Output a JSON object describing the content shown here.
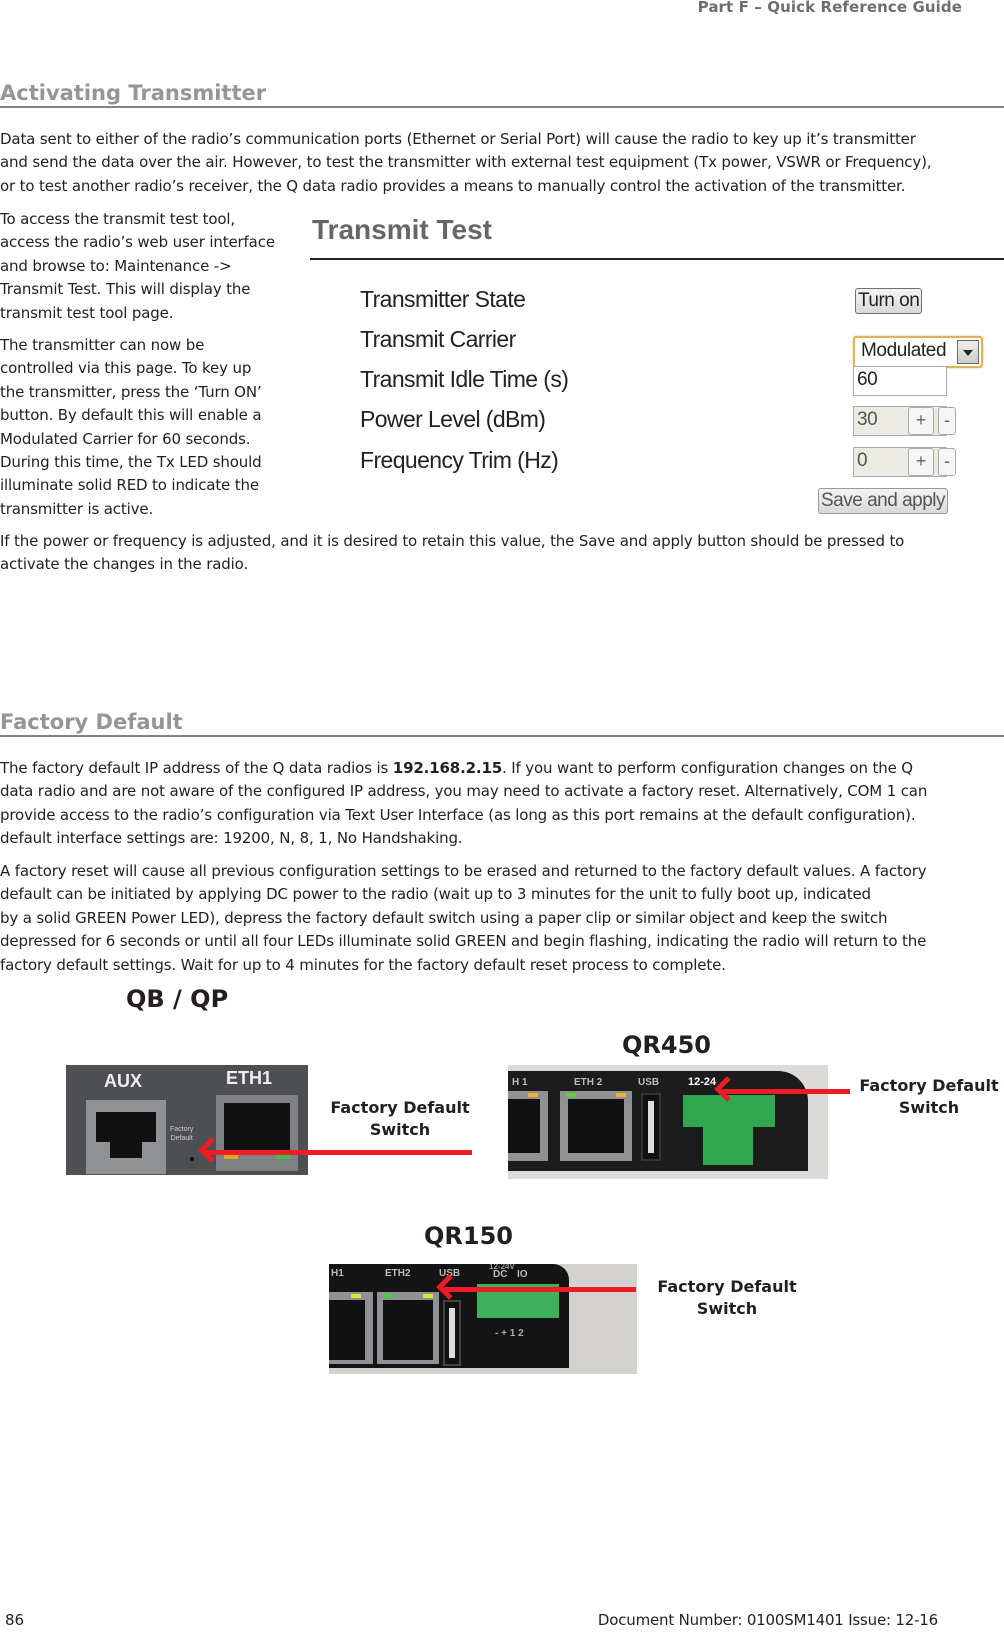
{
  "header": {
    "title": "Part F – Quick Reference Guide"
  },
  "activating": {
    "title": "Activating Transmitter",
    "intro_lines": [
      "Data sent to either of the radio’s communication ports (Ethernet or Serial Port) will cause the radio to key up it’s transmitter",
      "and send the data over the air. However, to test the transmitter with external test equipment (Tx power, VSWR or Frequency),",
      "or to test another radio’s receiver, the Q data radio provides a means to manually control the activation of the transmitter."
    ],
    "access_lines": [
      "To access the transmit test tool,",
      "access the radio’s web user interface",
      "and browse to: Maintenance ->",
      "Transmit Test. This will display the",
      "transmit test tool page."
    ],
    "control_lines": [
      "The transmitter can now be",
      "controlled via this page. To key up",
      "the transmitter, press the ‘Turn ON’",
      "button. By default this will enable a",
      "Modulated Carrier for 60 seconds.",
      "During this time, the Tx LED should",
      "illuminate solid RED to indicate the",
      "transmitter is active."
    ],
    "save_lines": [
      "If the power or frequency is adjusted, and it is desired to retain this value, the Save and apply button should be pressed to",
      "activate the changes in the radio."
    ]
  },
  "transmit_test": {
    "title": "Transmit Test",
    "rows": [
      {
        "label": "Transmitter State"
      },
      {
        "label": "Transmit Carrier"
      },
      {
        "label": "Transmit Idle Time (s)"
      },
      {
        "label": "Power Level (dBm)"
      },
      {
        "label": "Frequency Trim (Hz)"
      }
    ],
    "turn_on_label": "Turn on",
    "carrier_selected": "Modulated",
    "idle_time_value": "60",
    "power_level_value": "30",
    "frequency_trim_value": "0",
    "plus_label": "+",
    "minus_label": "-",
    "save_label": "Save and apply"
  },
  "factory": {
    "title": "Factory Default",
    "p1_line1_pre": "The factory default IP address of the Q data radios is ",
    "p1_ip": "192.168.2.15",
    "p1_line1_post": ". If you want to perform configuration changes on the Q",
    "p1_lines": [
      "data radio and are not aware of the configured IP address, you may need to activate a factory reset. Alternatively, COM 1 can",
      "provide access to the radio’s configuration via Text User Interface (as long as this port remains at the default configuration).",
      "default interface settings are: 19200, N, 8, 1, No Handshaking."
    ],
    "p2_lines": [
      "A factory reset will cause all previous configuration settings to be erased and returned to the factory default values. A factory",
      "default can be initiated by applying DC power to the radio (wait up to 3 minutes for the unit to fully boot up, indicated",
      "by a solid GREEN Power LED), depress the factory default switch using a paper clip or similar object and keep the switch",
      "depressed for 6 seconds or until all four LEDs illuminate solid GREEN and begin flashing, indicating the radio will return to the",
      "factory default settings. Wait for up to 4 minutes for the factory default reset process to complete."
    ]
  },
  "devices": [
    {
      "model": "QB / QP",
      "callout_line1": "Factory Default",
      "callout_line2": "Switch",
      "labels": {
        "aux": "AUX",
        "eth1": "ETH1",
        "fd1": "Factory",
        "fd2": "Default"
      }
    },
    {
      "model": "QR450",
      "callout_line1": "Factory Default",
      "callout_line2": "Switch",
      "labels": {
        "eth1": "H 1",
        "eth2": "ETH 2",
        "usb": "USB",
        "power": "12-24"
      }
    },
    {
      "model": "QR150",
      "callout_line1": "Factory Default",
      "callout_line2": "Switch",
      "labels": {
        "eth1": "H1",
        "eth2": "ETH2",
        "usb": "USB",
        "volt": "12-24V",
        "dc": "DC",
        "io": "IO",
        "pins": "- + 1 2"
      }
    }
  ],
  "footer": {
    "page_number": "86",
    "document": "Document Number: 0100SM1401   Issue: 12-16"
  }
}
